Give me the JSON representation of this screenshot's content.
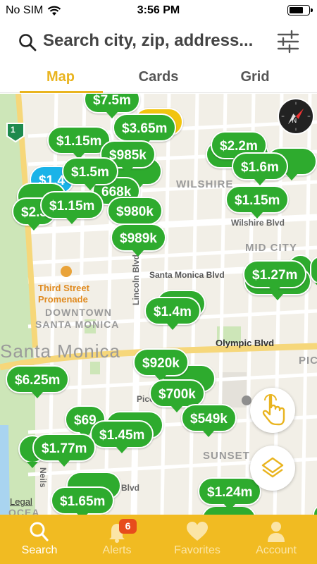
{
  "status_bar": {
    "carrier": "No SIM",
    "time": "3:56 PM"
  },
  "search": {
    "placeholder": "Search city, zip, address..."
  },
  "tabs": [
    {
      "label": "Map",
      "active": true
    },
    {
      "label": "Cards",
      "active": false
    },
    {
      "label": "Grid",
      "active": false
    }
  ],
  "map": {
    "labels": {
      "wilshire": "WILSHIRE",
      "wilshire_blvd": "Wilshire Blvd",
      "mid_city": "MID CITY",
      "santa_monica_blvd": "Santa Monica Blvd",
      "third_street_line1": "Third Street",
      "third_street_line2": "Promenade",
      "downtown_line1": "DOWNTOWN",
      "downtown_line2": "SANTA MONICA",
      "lincoln_blvd": "Lincoln Blvd",
      "city": "Santa Monica",
      "olympic_blvd": "Olympic Blvd",
      "pic_right": "PIC",
      "pico": "Pico",
      "sunset": "SUNSET",
      "ocean": "OCEA",
      "neilson": "Neils",
      "blvd": "Blvd",
      "highway_shield": "1",
      "legal": "Legal"
    },
    "prices": [
      {
        "label": "$7.5m",
        "color": "green"
      },
      {
        "label": "$3.65m",
        "color": "green"
      },
      {
        "label": "$1.15m",
        "color": "green"
      },
      {
        "label": "$985k",
        "color": "green"
      },
      {
        "label": "$2.2m",
        "color": "green"
      },
      {
        "label": "$1.6m",
        "color": "green"
      },
      {
        "label": "$1.5m",
        "color": "green"
      },
      {
        "label": "668k",
        "color": "green"
      },
      {
        "label": "$1.15m",
        "color": "green"
      },
      {
        "label": "$980k",
        "color": "green"
      },
      {
        "label": "$1.15m",
        "color": "green"
      },
      {
        "label": "$2.3",
        "color": "green"
      },
      {
        "label": "$989k",
        "color": "green"
      },
      {
        "label": "$1.27m",
        "color": "green"
      },
      {
        "label": "$1.4m",
        "color": "green"
      },
      {
        "label": "$6.25m",
        "color": "green"
      },
      {
        "label": "$920k",
        "color": "green"
      },
      {
        "label": "$700k",
        "color": "green"
      },
      {
        "label": "$549k",
        "color": "green"
      },
      {
        "label": "$69",
        "color": "green"
      },
      {
        "label": "$1.45m",
        "color": "green"
      },
      {
        "label": "$1.77m",
        "color": "green"
      },
      {
        "label": "$1.24m",
        "color": "green"
      },
      {
        "label": "$1.65m",
        "color": "green"
      }
    ]
  },
  "tab_bar": {
    "items": [
      {
        "label": "Search",
        "icon": "search-icon",
        "active": true
      },
      {
        "label": "Alerts",
        "icon": "bell-icon",
        "badge": "6"
      },
      {
        "label": "Favorites",
        "icon": "heart-icon"
      },
      {
        "label": "Account",
        "icon": "person-icon"
      }
    ]
  },
  "colors": {
    "accent": "#e9b41f",
    "tab_bar": "#f1bb22",
    "pin": "#2eab2e",
    "badge": "#e74c1c"
  }
}
